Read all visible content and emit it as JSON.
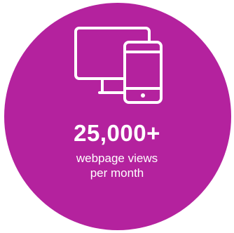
{
  "stat": {
    "icon": "desktop-and-phone-icon",
    "number": "25,000+",
    "label_line1": "webpage views",
    "label_line2": "per month",
    "background_color": "#b4229e",
    "text_color": "#ffffff"
  }
}
